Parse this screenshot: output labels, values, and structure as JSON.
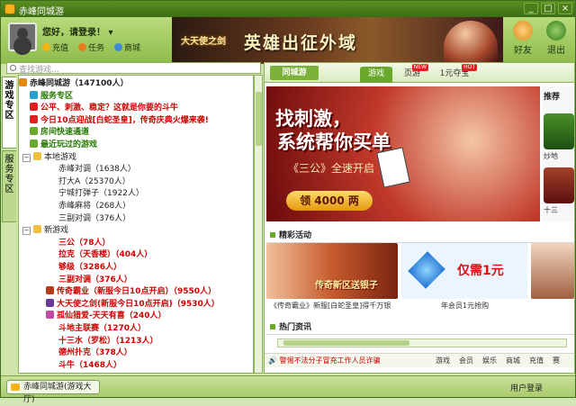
{
  "window": {
    "title": "赤峰同城游"
  },
  "header": {
    "greeting": "您好，请登录！",
    "links": [
      "充值",
      "任务",
      "商城"
    ],
    "banner_logo": "大天使之剑",
    "banner_text": "英雄出征外域",
    "buttons": [
      {
        "label": "好友",
        "icon": "friends-icon"
      },
      {
        "label": "退出",
        "icon": "exit-icon"
      }
    ]
  },
  "search": {
    "placeholder": "查找游戏..."
  },
  "side_tabs": [
    "游戏专区",
    "服务专区"
  ],
  "tree": [
    {
      "text": "赤峰同城游（147100人）",
      "cls": "dark bold",
      "indent": 0,
      "icon": "home"
    },
    {
      "text": "服务专区",
      "cls": "green bold",
      "indent": 12,
      "icon": "diamond"
    },
    {
      "text": "公平、刺激、稳定？这就是你要的斗牛",
      "cls": "red bold",
      "indent": 12,
      "icon": "hot"
    },
    {
      "text": "今日10点迎战[白蛇圣皇]，传奇庆典火爆来袭!",
      "cls": "red bold",
      "indent": 12,
      "icon": "hot"
    },
    {
      "text": "房间快速通道",
      "cls": "green bold",
      "indent": 12,
      "icon": "fold"
    },
    {
      "text": "最近玩过的游戏",
      "cls": "green bold",
      "indent": 12,
      "icon": "fold"
    },
    {
      "text": "本地游戏",
      "cls": "dark",
      "indent": 4,
      "icon": "folder",
      "tw": "−"
    },
    {
      "text": "赤峰对调（1638人）",
      "cls": "dark",
      "indent": 44,
      "icon": "none"
    },
    {
      "text": "打大A（25370人）",
      "cls": "dark",
      "indent": 44,
      "icon": "none"
    },
    {
      "text": "宁城打弹子（1922人）",
      "cls": "dark",
      "indent": 44,
      "icon": "none"
    },
    {
      "text": "赤峰麻将（268人）",
      "cls": "dark",
      "indent": 44,
      "icon": "none"
    },
    {
      "text": "三副对调（376人）",
      "cls": "dark",
      "indent": 44,
      "icon": "none"
    },
    {
      "text": "新游戏",
      "cls": "dark",
      "indent": 4,
      "icon": "folder",
      "tw": "−"
    },
    {
      "text": "三公（78人）",
      "cls": "red bold",
      "indent": 44,
      "icon": "none"
    },
    {
      "text": "拉克（天香楼）（404人）",
      "cls": "red bold",
      "indent": 44,
      "icon": "none"
    },
    {
      "text": "够级（3286人）",
      "cls": "red bold",
      "indent": 44,
      "icon": "none"
    },
    {
      "text": "三副对调（376人）",
      "cls": "red bold",
      "indent": 44,
      "icon": "none"
    },
    {
      "text": "传奇霸业（新服今日10点开启）（9550人）",
      "cls": "red bold",
      "indent": 30,
      "icon": "game1"
    },
    {
      "text": "大天使之剑(新服今日10点开启)（9530人）",
      "cls": "red bold",
      "indent": 30,
      "icon": "game2"
    },
    {
      "text": "孤仙猎爱-天天有喜（240人）",
      "cls": "red bold",
      "indent": 30,
      "icon": "game3"
    },
    {
      "text": "斗地主联赛（1270人）",
      "cls": "red bold",
      "indent": 44,
      "icon": "none"
    },
    {
      "text": "十三水（罗松）（1213人）",
      "cls": "red bold",
      "indent": 44,
      "icon": "none"
    },
    {
      "text": "德州扑克（378人）",
      "cls": "red bold",
      "indent": 44,
      "icon": "none"
    },
    {
      "text": "斗牛（1468人）",
      "cls": "red bold",
      "indent": 44,
      "icon": "none"
    }
  ],
  "main": {
    "brand": "同城游",
    "tabs": [
      {
        "label": "游戏",
        "active": true,
        "badge": ""
      },
      {
        "label": "页游",
        "active": false,
        "badge": "NEW"
      },
      {
        "label": "1元夺宝",
        "active": false,
        "badge": "HOT"
      }
    ],
    "promo": {
      "line1": "找刺激，",
      "line2": "系统帮你买单",
      "line3": "《三公》全速开启",
      "button": "领 4000 两"
    },
    "recommend": {
      "title": "推荐",
      "games": [
        "炒地",
        "十三"
      ]
    },
    "activities_title": "精彩活动",
    "activities": [
      {
        "caption": "《传奇霸业》新服[白蛇圣皇]得千万银",
        "img_text": "传奇新区送银子"
      },
      {
        "caption": "年会员1元抢购",
        "img_text": "仅需1元"
      }
    ],
    "news_title": "热门资讯",
    "tips": {
      "warning": "警惕不法分子冒充工作人员诈骗",
      "links": [
        "游戏",
        "会员",
        "娱乐",
        "商城",
        "充值",
        "赛"
      ]
    }
  },
  "status": {
    "tab": "赤峰同城游(游戏大厅)",
    "login": "用户登录"
  }
}
